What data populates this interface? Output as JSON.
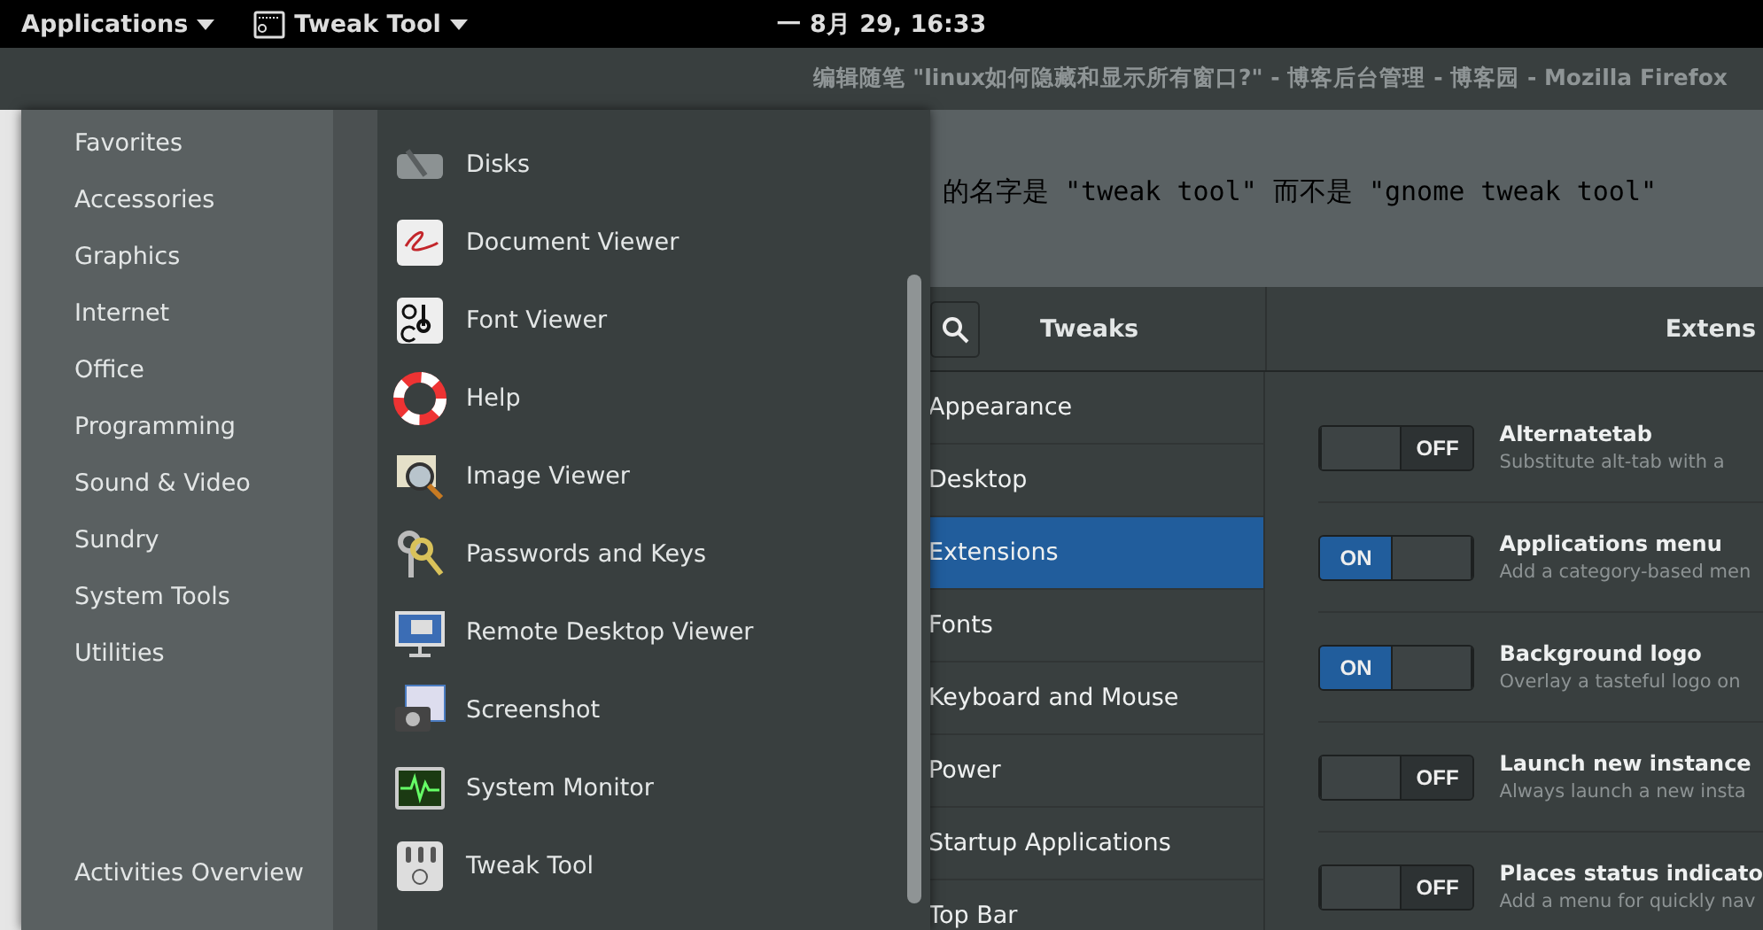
{
  "top_bar": {
    "menus": [
      {
        "label": "Applications",
        "kind": "plain"
      },
      {
        "label": "Tweak Tool",
        "kind": "app"
      }
    ],
    "clock": "一 8月 29, 16:33"
  },
  "browser": {
    "title": "编辑随笔 \"linux如何隐藏和显示所有窗口?\" - 博客后台管理 - 博客园 - Mozilla Firefox",
    "text": "的名字是 \"tweak tool\" 而不是 \"gnome tweak tool\""
  },
  "app_menu": {
    "categories": [
      "Favorites",
      "Accessories",
      "Graphics",
      "Internet",
      "Office",
      "Programming",
      "Sound & Video",
      "Sundry",
      "System Tools",
      "Utilities"
    ],
    "footer": "Activities Overview",
    "apps": [
      {
        "name": "Disks",
        "kind": "disks"
      },
      {
        "name": "Document Viewer",
        "kind": "document"
      },
      {
        "name": "Font Viewer",
        "kind": "font"
      },
      {
        "name": "Help",
        "kind": "help"
      },
      {
        "name": "Image Viewer",
        "kind": "image"
      },
      {
        "name": "Passwords and Keys",
        "kind": "keys"
      },
      {
        "name": "Remote Desktop Viewer",
        "kind": "remote"
      },
      {
        "name": "Screenshot",
        "kind": "screenshot"
      },
      {
        "name": "System Monitor",
        "kind": "monitor"
      },
      {
        "name": "Tweak Tool",
        "kind": "tweak"
      }
    ]
  },
  "tweaks": {
    "header_title": "Tweaks",
    "page_title": "Extens",
    "sections": [
      {
        "label": "Appearance",
        "selected": false
      },
      {
        "label": "Desktop",
        "selected": false
      },
      {
        "label": "Extensions",
        "selected": true
      },
      {
        "label": "Fonts",
        "selected": false
      },
      {
        "label": "Keyboard and Mouse",
        "selected": false
      },
      {
        "label": "Power",
        "selected": false
      },
      {
        "label": "Startup Applications",
        "selected": false
      },
      {
        "label": "Top Bar",
        "selected": false
      }
    ],
    "extensions": [
      {
        "name": "Alternatetab",
        "description": "Substitute alt-tab with a",
        "on": false,
        "switch_label": "OFF"
      },
      {
        "name": "Applications menu",
        "description": "Add a category-based men",
        "on": true,
        "switch_label": "ON"
      },
      {
        "name": "Background logo",
        "description": "Overlay a tasteful logo on",
        "on": true,
        "switch_label": "ON"
      },
      {
        "name": "Launch new instance",
        "description": "Always launch a new insta",
        "on": false,
        "switch_label": "OFF"
      },
      {
        "name": "Places status indicato",
        "description": "Add a menu for quickly nav",
        "on": false,
        "switch_label": "OFF"
      }
    ]
  }
}
